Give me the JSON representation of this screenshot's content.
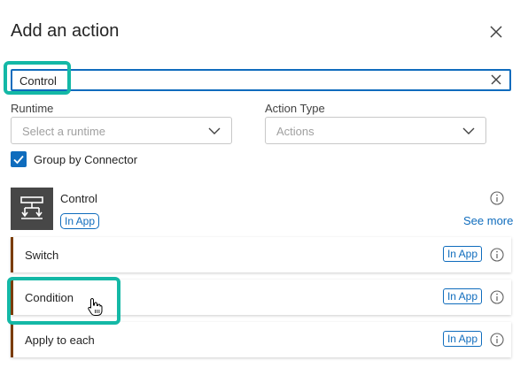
{
  "panel": {
    "title": "Add an action",
    "close_icon": "close-icon"
  },
  "search": {
    "value": "Control",
    "clear_icon": "clear-icon"
  },
  "filters": {
    "runtime": {
      "label": "Runtime",
      "placeholder": "Select a runtime"
    },
    "action_type": {
      "label": "Action Type",
      "placeholder": "Actions"
    }
  },
  "group_by_connector": {
    "label": "Group by Connector",
    "checked": true
  },
  "connector": {
    "name": "Control",
    "badge": "In App",
    "see_more": "See more",
    "icon": "control-connector-icon"
  },
  "actions": [
    {
      "label": "Switch",
      "badge": "In App"
    },
    {
      "label": "Condition",
      "badge": "In App"
    },
    {
      "label": "Apply to each",
      "badge": "In App"
    }
  ],
  "colors": {
    "accent": "#0f6cbd",
    "highlight": "#14b8a6",
    "row_stripe": "#7a3c00",
    "connector_icon_bg": "#474747"
  }
}
